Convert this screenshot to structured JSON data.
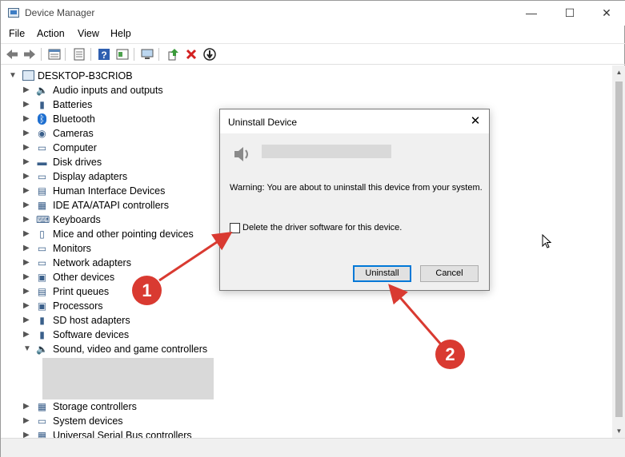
{
  "window": {
    "title": "Device Manager",
    "controls": {
      "minimize": "—",
      "maximize": "☐",
      "close": "✕"
    }
  },
  "menu": [
    "File",
    "Action",
    "View",
    "Help"
  ],
  "tree": {
    "root": "DESKTOP-B3CRIOB",
    "items": [
      {
        "label": "Audio inputs and outputs",
        "icon": "speaker-icon",
        "glyph": "🔈",
        "expanded": false
      },
      {
        "label": "Batteries",
        "icon": "battery-icon",
        "glyph": "▮",
        "expanded": false
      },
      {
        "label": "Bluetooth",
        "icon": "bluetooth-icon",
        "glyph": "ᛒ",
        "expanded": false
      },
      {
        "label": "Cameras",
        "icon": "camera-icon",
        "glyph": "◉",
        "expanded": false
      },
      {
        "label": "Computer",
        "icon": "computer-icon",
        "glyph": "▭",
        "expanded": false
      },
      {
        "label": "Disk drives",
        "icon": "disk-drive-icon",
        "glyph": "▬",
        "expanded": false
      },
      {
        "label": "Display adapters",
        "icon": "display-adapter-icon",
        "glyph": "▭",
        "expanded": false
      },
      {
        "label": "Human Interface Devices",
        "icon": "hid-icon",
        "glyph": "▤",
        "expanded": false
      },
      {
        "label": "IDE ATA/ATAPI controllers",
        "icon": "ide-controller-icon",
        "glyph": "▦",
        "expanded": false
      },
      {
        "label": "Keyboards",
        "icon": "keyboard-icon",
        "glyph": "⌨",
        "expanded": false
      },
      {
        "label": "Mice and other pointing devices",
        "icon": "mouse-icon",
        "glyph": "▯",
        "expanded": false
      },
      {
        "label": "Monitors",
        "icon": "monitor-icon",
        "glyph": "▭",
        "expanded": false
      },
      {
        "label": "Network adapters",
        "icon": "network-adapter-icon",
        "glyph": "▭",
        "expanded": false
      },
      {
        "label": "Other devices",
        "icon": "other-devices-icon",
        "glyph": "▣",
        "expanded": false
      },
      {
        "label": "Print queues",
        "icon": "printer-icon",
        "glyph": "▤",
        "expanded": false
      },
      {
        "label": "Processors",
        "icon": "processor-icon",
        "glyph": "▣",
        "expanded": false
      },
      {
        "label": "SD host adapters",
        "icon": "sd-adapter-icon",
        "glyph": "▮",
        "expanded": false
      },
      {
        "label": "Software devices",
        "icon": "software-device-icon",
        "glyph": "▮",
        "expanded": false
      },
      {
        "label": "Sound, video and game controllers",
        "icon": "sound-controller-icon",
        "glyph": "🔈",
        "expanded": true
      },
      {
        "label": "Storage controllers",
        "icon": "storage-controller-icon",
        "glyph": "▦",
        "expanded": false
      },
      {
        "label": "System devices",
        "icon": "system-devices-icon",
        "glyph": "▭",
        "expanded": false
      },
      {
        "label": "Universal Serial Bus controllers",
        "icon": "usb-controller-icon",
        "glyph": "▦",
        "expanded": false
      }
    ]
  },
  "dialog": {
    "title": "Uninstall Device",
    "warning": "Warning: You are about to uninstall this device from your system.",
    "checkbox_label": "Delete the driver software for this device.",
    "checkbox_checked": false,
    "uninstall_label": "Uninstall",
    "cancel_label": "Cancel"
  },
  "annotations": {
    "step1": "1",
    "step2": "2",
    "color": "#d93a31"
  },
  "colors": {
    "accent": "#0078d7",
    "annotation": "#d93a31"
  }
}
